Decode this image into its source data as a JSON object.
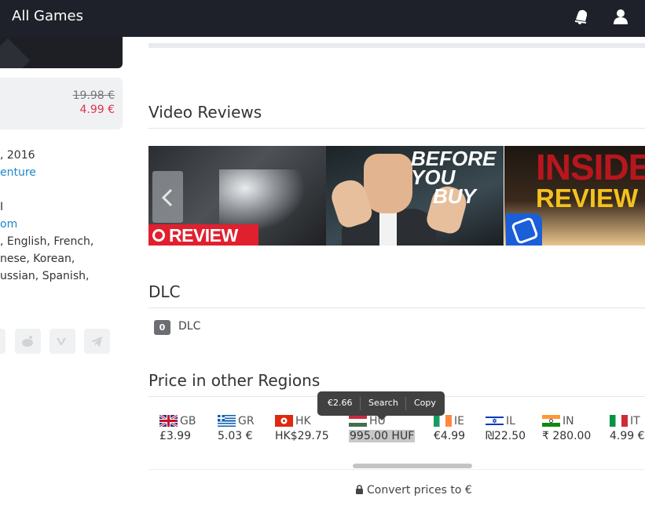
{
  "header": {
    "title": "All Games",
    "icons": [
      "notification-bell-icon",
      "user-icon"
    ]
  },
  "sidebar": {
    "price": {
      "old": "19.98 €",
      "current": "4.99 €"
    },
    "release_fragment": ", 2016",
    "genre_fragment": "enture",
    "char_fragment": "I",
    "link_fragment": "om",
    "languages": [
      ", English, French,",
      "nese, Korean,",
      "ussian, Spanish,"
    ],
    "share_icons": [
      "share-icon",
      "reddit-icon",
      "vk-icon",
      "telegram-icon"
    ]
  },
  "video_reviews": {
    "title": "Video Reviews",
    "thumbnails": [
      {
        "overlay": "REVIEW"
      },
      {
        "overlay_top": "BEFORE",
        "overlay_mid": "YOU",
        "overlay_bottom": "BUY"
      },
      {
        "overlay_top": "INSIDE",
        "overlay_bottom": "REVIEW"
      }
    ]
  },
  "dlc": {
    "title": "DLC",
    "count": "0",
    "label": "DLC"
  },
  "regions": {
    "title": "Price in other Regions",
    "items": [
      {
        "code": "GB",
        "price": "£3.99"
      },
      {
        "code": "GR",
        "price": "5.03 €"
      },
      {
        "code": "HK",
        "price": "HK$29.75"
      },
      {
        "code": "HU",
        "price": "995.00 HUF"
      },
      {
        "code": "IE",
        "price": "€4.99"
      },
      {
        "code": "IL",
        "price": "₪22.50"
      },
      {
        "code": "IN",
        "price": "₹ 280.00"
      },
      {
        "code": "IT",
        "price": "4.99 €"
      }
    ],
    "convert_label": "Convert prices to €"
  },
  "context_menu": {
    "conversion": "€2.66",
    "search": "Search",
    "copy": "Copy"
  }
}
